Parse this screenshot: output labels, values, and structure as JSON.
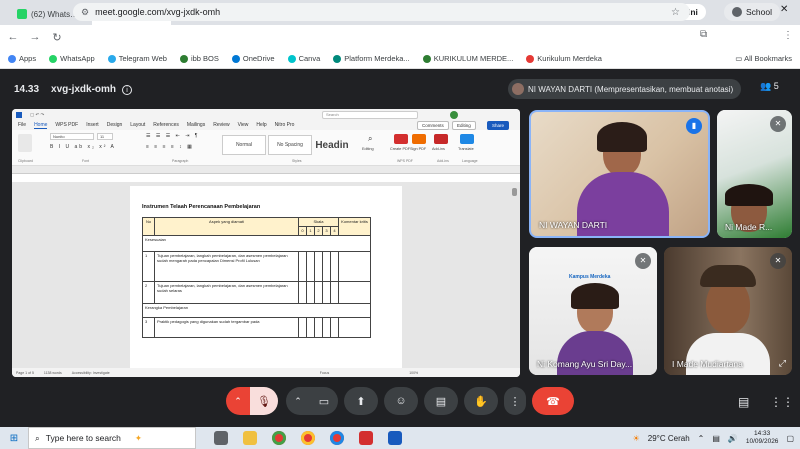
{
  "browser": {
    "tabs": [
      {
        "title": "(62) WhatsApp",
        "color": "#25d366",
        "active": false
      },
      {
        "title": "Meet - xvg",
        "color": "#00897b",
        "active": true
      },
      {
        "title": "Lembar Kerja",
        "color": "#4285f4",
        "active": false
      },
      {
        "title": "1. STUDI KASUS",
        "color": "#4285f4",
        "active": false
      },
      {
        "title": "Dashboard",
        "color": "#3c4043",
        "active": false
      },
      {
        "title": "Beranda - 1 h",
        "color": "#3c4043",
        "active": false
      },
      {
        "title": "Apresiasi GTK",
        "color": "#5f6368",
        "active": false
      }
    ],
    "new_tab": "+",
    "ask_gemini": "Ask Gemini",
    "url": "meet.google.com/xvg-jxdk-omh",
    "profile": "School",
    "bookmarks": [
      "Apps",
      "WhatsApp",
      "Telegram Web",
      "ibb BOS",
      "OneDrive",
      "Canva",
      "Platform Merdeka...",
      "KURIKULUM MERDE...",
      "Kurikulum Merdeka"
    ],
    "all_bookmarks": "All Bookmarks"
  },
  "meet": {
    "time": "14.33",
    "code": "xvg-jxdk-omh",
    "presenter": "NI WAYAN DARTI (Mempresentasikan, membuat anotasi)",
    "participant_count": "5",
    "participants": [
      {
        "name": "NI WAYAN DARTI",
        "speaking": true
      },
      {
        "name": "Ni Made R..."
      },
      {
        "name": "Ni Komang Ayu Sri Day..."
      },
      {
        "name": "I Made Mudiartana"
      }
    ],
    "tile_logo": "Kampus Merdeka"
  },
  "word": {
    "menu": [
      "File",
      "Home",
      "WPS PDF",
      "Insert",
      "Design",
      "Layout",
      "References",
      "Mailings",
      "Review",
      "View",
      "Help",
      "Nitro Pro"
    ],
    "comments_btn": "Comments",
    "editing_btn": "Editing",
    "share_btn": "Share",
    "search_placeholder": "Search",
    "font_name": "Nunito",
    "font_size": "11",
    "styles": [
      "Normal",
      "No Spacing",
      "Headin"
    ],
    "ribbon_groups": [
      "Clipboard",
      "Font",
      "Paragraph",
      "Styles",
      "WPS PDF",
      "Add-ins",
      "Language"
    ],
    "ribbon_tools": [
      "Editing",
      "Create PDF",
      "Sign PDF",
      "Add-ins",
      "Translate"
    ],
    "doc_title": "Instrumen Telaah Perencanaan Pembelajaran",
    "table": {
      "h_no": "No",
      "h_aspek": "Aspek yang diamati",
      "h_skala": "Skala",
      "h_komentar": "Komentar kritis",
      "scale": [
        "0",
        "1",
        "2",
        "3",
        "4"
      ],
      "sec1": "Kesesuaian",
      "row1_no": "1",
      "row1_text": "Tujuan pembelajaran, langkah pembelajaran, dan asesmen pembelajaran sudah mengarah pada pencapaian Dimensi Profil Lulusan",
      "row2_no": "2",
      "row2_text": "Tujuan pembelajaran, langkah pembelajaran, dan asesmen pembelajaran sudah selaras",
      "sec2": "Kerangka Pembelajaran",
      "row3_no": "3",
      "row3_text": "Praktik pedagogis yang digunakan sudah tergambar pada"
    },
    "status": [
      "Page 1 of 5",
      "1138 words",
      "Accessibility: Investigate",
      "Focus",
      "100%"
    ]
  },
  "taskbar": {
    "search": "Type here to search",
    "weather": "29°C  Cerah",
    "time": "14:33",
    "date": "10/09/2026"
  }
}
